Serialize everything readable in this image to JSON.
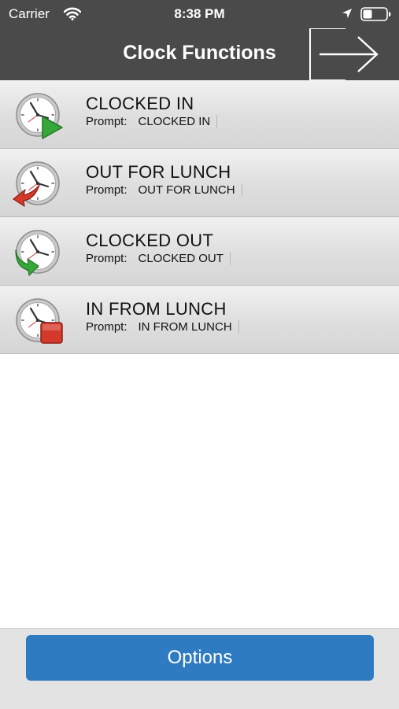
{
  "status_bar": {
    "carrier": "Carrier",
    "time": "8:38 PM",
    "wifi_icon": "wifi-icon",
    "location_icon": "location-arrow-icon",
    "battery_icon": "battery-icon"
  },
  "nav": {
    "title": "Clock Functions",
    "exit_icon": "exit-arrow-icon"
  },
  "rows": [
    {
      "title": "CLOCKED IN",
      "prompt_label": "Prompt:",
      "prompt_value": "CLOCKED IN",
      "icon": "clock-in-icon",
      "badge_color": "#36a83a"
    },
    {
      "title": "OUT FOR LUNCH",
      "prompt_label": "Prompt:",
      "prompt_value": "OUT FOR LUNCH",
      "icon": "out-for-lunch-icon",
      "badge_color": "#d33a2c"
    },
    {
      "title": "CLOCKED OUT",
      "prompt_label": "Prompt:",
      "prompt_value": "CLOCKED OUT",
      "icon": "clock-out-icon",
      "badge_color": "#36a83a"
    },
    {
      "title": "IN FROM LUNCH",
      "prompt_label": "Prompt:",
      "prompt_value": "IN FROM LUNCH",
      "icon": "in-from-lunch-icon",
      "badge_color": "#d33a2c"
    }
  ],
  "footer": {
    "options_label": "Options"
  },
  "colors": {
    "header_bg": "#4a4a4a",
    "button_blue": "#2f7bc2"
  }
}
